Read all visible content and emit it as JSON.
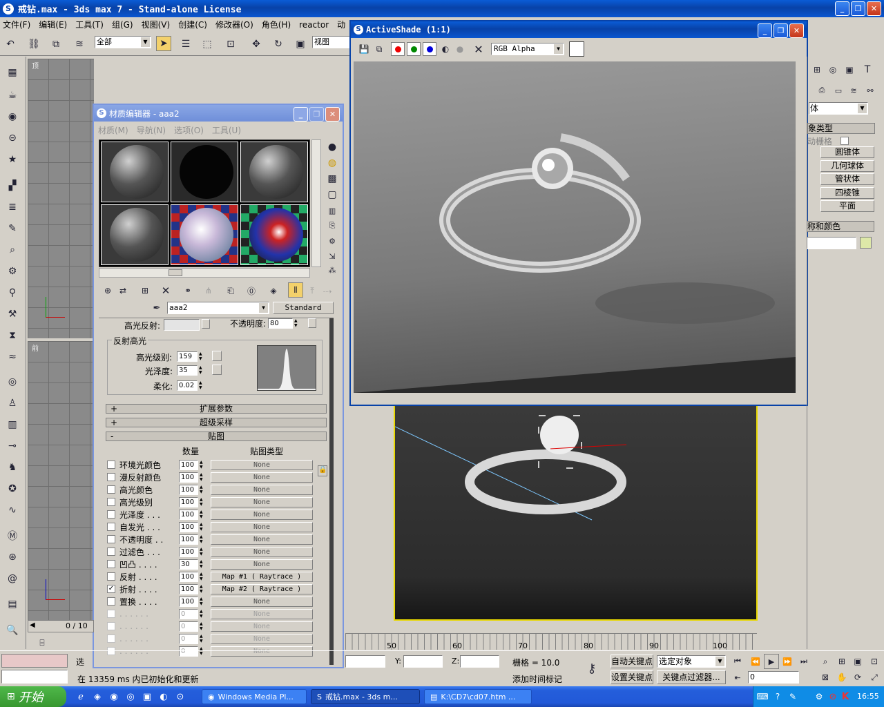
{
  "app": {
    "title": "戒钻.max - 3ds max 7 - Stand-alone License"
  },
  "menu": [
    "文件(F)",
    "编辑(E)",
    "工具(T)",
    "组(G)",
    "视图(V)",
    "创建(C)",
    "修改器(O)",
    "角色(H)",
    "reactor",
    "动"
  ],
  "toolbar": {
    "selection_filter": "全部",
    "ref_coord": "视图"
  },
  "viewports": {
    "top_label": "顶",
    "front_label": "前"
  },
  "activeshade": {
    "title": "ActiveShade (1:1)",
    "channel": "RGB Alpha"
  },
  "mat_editor": {
    "title": "材质编辑器 - aaa2",
    "menu": [
      "材质(M)",
      "导航(N)",
      "选项(O)",
      "工具(U)"
    ],
    "material_name": "aaa2",
    "material_type": "Standard",
    "specular_label": "高光反射:",
    "opacity_label": "不透明度:",
    "opacity_value": "80",
    "spec_group_title": "反射高光",
    "spec_level_label": "高光级别:",
    "spec_level_value": "159",
    "gloss_label": "光泽度:",
    "gloss_value": "35",
    "soften_label": "柔化:",
    "soften_value": "0.02",
    "rollouts": [
      {
        "sign": "+",
        "title": "扩展参数"
      },
      {
        "sign": "+",
        "title": "超级采样"
      },
      {
        "sign": "-",
        "title": "贴图"
      }
    ],
    "maps_header_amount": "数量",
    "maps_header_type": "贴图类型",
    "maps": [
      {
        "checked": false,
        "label": "环境光颜色",
        "amount": "100",
        "map": "None"
      },
      {
        "checked": false,
        "label": "漫反射颜色",
        "amount": "100",
        "map": "None"
      },
      {
        "checked": false,
        "label": "高光颜色",
        "amount": "100",
        "map": "None"
      },
      {
        "checked": false,
        "label": "高光级别",
        "amount": "100",
        "map": "None"
      },
      {
        "checked": false,
        "label": "光泽度 . . .",
        "amount": "100",
        "map": "None"
      },
      {
        "checked": false,
        "label": "自发光 . . .",
        "amount": "100",
        "map": "None"
      },
      {
        "checked": false,
        "label": "不透明度 . .",
        "amount": "100",
        "map": "None"
      },
      {
        "checked": false,
        "label": "过滤色 . . .",
        "amount": "100",
        "map": "None"
      },
      {
        "checked": false,
        "label": "凹凸 . . . .",
        "amount": "30",
        "map": "None"
      },
      {
        "checked": false,
        "label": "反射 . . . .",
        "amount": "100",
        "map": "Map #1  ( Raytrace )"
      },
      {
        "checked": true,
        "label": "折射 . . . .",
        "amount": "100",
        "map": "Map #2  ( Raytrace )"
      },
      {
        "checked": false,
        "label": "置换 . . . .",
        "amount": "100",
        "map": "None"
      },
      {
        "checked": false,
        "label": ". . . . . .",
        "amount": "0",
        "map": "None"
      },
      {
        "checked": false,
        "label": ". . . . . .",
        "amount": "0",
        "map": "None"
      },
      {
        "checked": false,
        "label": ". . . . . .",
        "amount": "0",
        "map": "None"
      },
      {
        "checked": false,
        "label": ". . . . . .",
        "amount": "0",
        "map": "None"
      }
    ]
  },
  "command_panel": {
    "dropdown": "体",
    "rollout1": "象类型",
    "autogrid": "动栅格",
    "buttons": [
      "圆锥体",
      "几何球体",
      "管状体",
      "四棱锥",
      "平面"
    ],
    "rollout2": "称和颜色"
  },
  "timeline": {
    "frame": "0 / 10",
    "ticks": [
      "50",
      "60",
      "70",
      "80",
      "90",
      "100"
    ]
  },
  "status": {
    "select_label": "选",
    "message": "在 13359 ms 内已初始化和更新",
    "y_label": "Y:",
    "z_label": "Z:",
    "grid": "栅格 = 10.0",
    "add_time_tag": "添加时间标记",
    "auto_key": "自动关键点",
    "set_key": "设置关键点",
    "selected_object": "选定对象",
    "key_filters": "关键点过滤器...",
    "frame_value": "0"
  },
  "taskbar": {
    "start": "开始",
    "tasks": [
      "Windows Media Pl...",
      "戒钻.max - 3ds m...",
      "K:\\CD7\\cd07.htm ..."
    ],
    "clock": "16:55"
  }
}
